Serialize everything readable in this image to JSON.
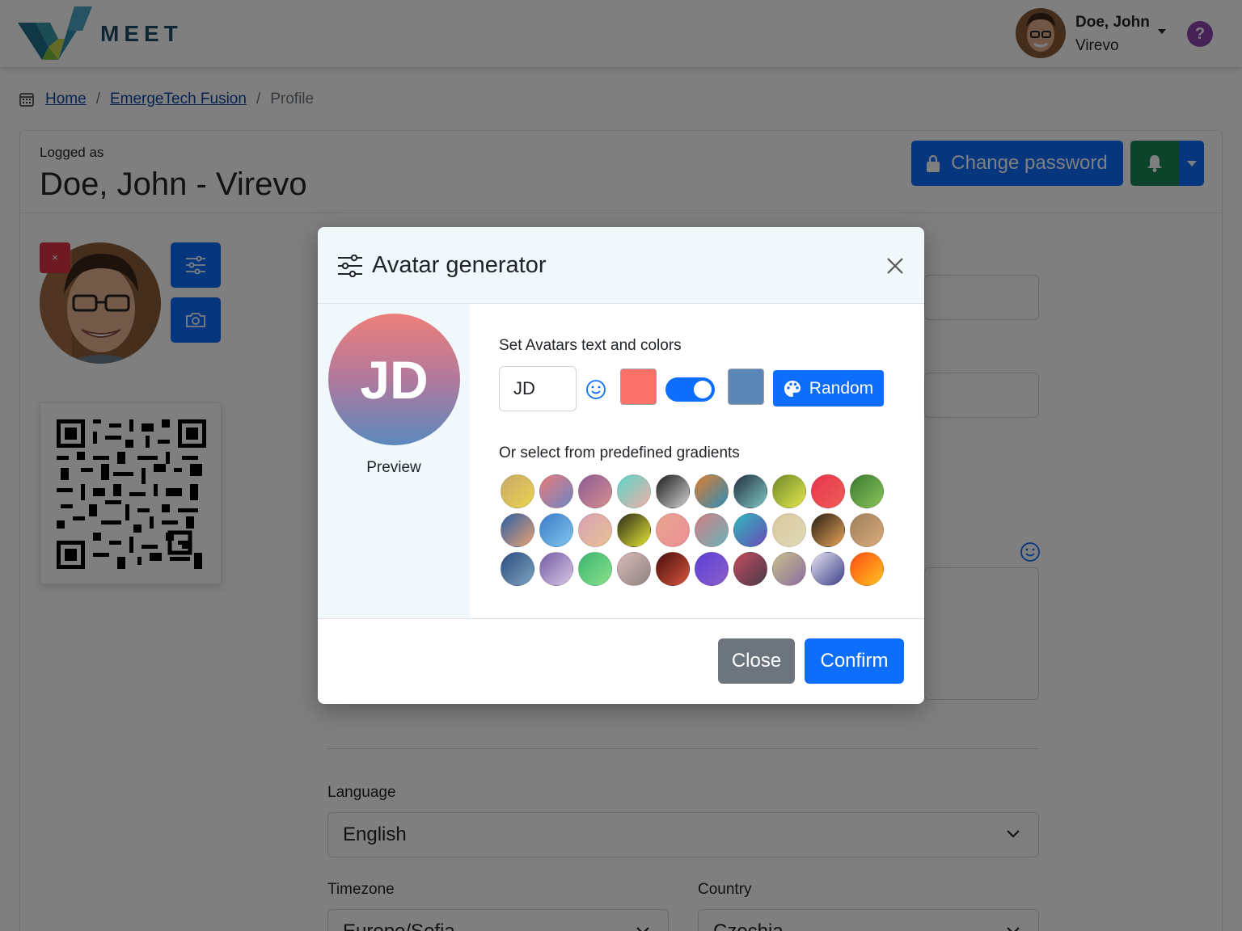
{
  "app": {
    "brand": "MEET"
  },
  "user": {
    "name": "Doe, John",
    "org": "Virevo",
    "help": "?"
  },
  "breadcrumb": {
    "items": [
      "Home",
      "EmergeTech Fusion",
      "Profile"
    ],
    "separator": "/"
  },
  "profile": {
    "logged_as_label": "Logged as",
    "name": "Doe, John",
    "dash": "-",
    "org": "Virevo",
    "change_password_label": "Change password",
    "remove_photo_label": "×"
  },
  "form": {
    "language_label": "Language",
    "language_value": "English",
    "timezone_label": "Timezone",
    "timezone_value": "Europe/Sofia",
    "country_label": "Country",
    "country_value": "Czechia"
  },
  "modal": {
    "title": "Avatar generator",
    "preview_text": "JD",
    "preview_label": "Preview",
    "set_label": "Set Avatars text and colors",
    "text_value": "JD",
    "color1": "#fa7268",
    "color2": "#5b87b6",
    "gradient_enabled": true,
    "random_label": "Random",
    "gradients_label": "Or select from predefined gradients",
    "gradients": [
      [
        "#c9a86b",
        "#e8d24e"
      ],
      [
        "#e87a7a",
        "#6d86c4"
      ],
      [
        "#8d5b96",
        "#d58f8f"
      ],
      [
        "#5bd6c8",
        "#f0b0a8"
      ],
      [
        "#1c1c1c",
        "#d0d0d0"
      ],
      [
        "#e07b30",
        "#2d8fb8"
      ],
      [
        "#24303f",
        "#7ec6c3"
      ],
      [
        "#6e8a2c",
        "#e4e54a"
      ],
      [
        "#e8344e",
        "#ed5d56"
      ],
      [
        "#3c7a32",
        "#88c458"
      ],
      [
        "#2c5ea3",
        "#e8a275"
      ],
      [
        "#3d7cc9",
        "#7ec6ee"
      ],
      [
        "#d8a0b4",
        "#e8c293"
      ],
      [
        "#2b2b1b",
        "#e3e335"
      ],
      [
        "#e8a690",
        "#ec8e94"
      ],
      [
        "#d07e84",
        "#6bb3b8"
      ],
      [
        "#2fb8ba",
        "#6a4bb8"
      ],
      [
        "#d9c89c",
        "#e0d9b8"
      ],
      [
        "#2a2014",
        "#e6a358"
      ],
      [
        "#9e7f5c",
        "#d8ab7a"
      ],
      [
        "#2c4e80",
        "#7fa3bf"
      ],
      [
        "#775ca6",
        "#d6c6e4"
      ],
      [
        "#3bb56f",
        "#8be08d"
      ],
      [
        "#d8b8b7",
        "#8f8581"
      ],
      [
        "#4a0e0e",
        "#d5553c"
      ],
      [
        "#5b3fd7",
        "#8c5fc9"
      ],
      [
        "#c34c5e",
        "#4a3a4a"
      ],
      [
        "#c8bf8d",
        "#8a6e9e"
      ],
      [
        "#e4e2ef",
        "#3c3f8a"
      ],
      [
        "#ff4d13",
        "#ffc21f"
      ]
    ],
    "close_label": "Close",
    "confirm_label": "Confirm"
  }
}
